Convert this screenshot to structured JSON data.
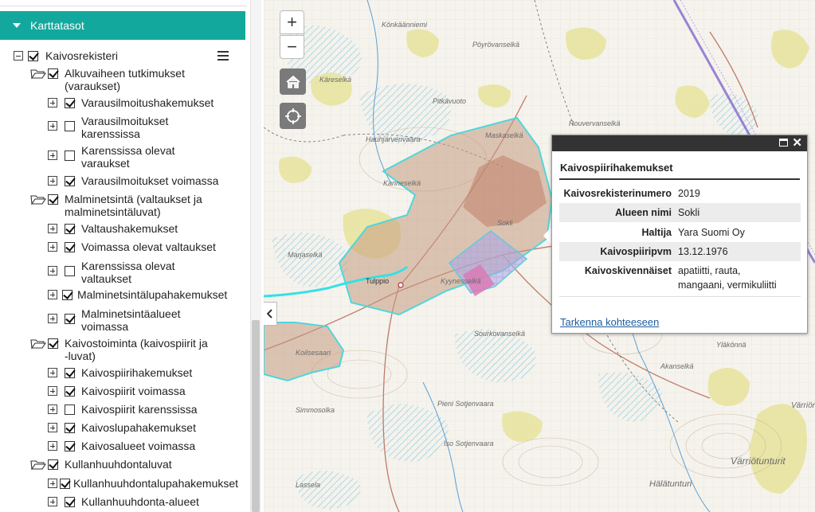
{
  "sidebar": {
    "header": "Karttatasot",
    "root": "Kaivosrekisteri",
    "groups": [
      {
        "label_l1": "Alkuvaiheen tutkimukset",
        "label_l2": "(varaukset)",
        "checked": true,
        "items": [
          {
            "l1": "Varausilmoitushakemukset",
            "l2": "",
            "checked": true
          },
          {
            "l1": "Varausilmoitukset",
            "l2": "karenssissa",
            "checked": false
          },
          {
            "l1": "Karenssissa olevat",
            "l2": "varaukset",
            "checked": false
          },
          {
            "l1": "Varausilmoitukset voimassa",
            "l2": "",
            "checked": true
          }
        ]
      },
      {
        "label_l1": "Malminetsintä (valtaukset ja",
        "label_l2": "malminetsintäluvat)",
        "checked": true,
        "items": [
          {
            "l1": "Valtaushakemukset",
            "l2": "",
            "checked": true
          },
          {
            "l1": "Voimassa olevat valtaukset",
            "l2": "",
            "checked": true
          },
          {
            "l1": "Karenssissa olevat",
            "l2": "valtaukset",
            "checked": false
          },
          {
            "l1": "Malminetsintälupahakemukset",
            "l2": "",
            "checked": true
          },
          {
            "l1": "Malminetsintäalueet",
            "l2": "voimassa",
            "checked": true
          }
        ]
      },
      {
        "label_l1": "Kaivostoiminta (kaivospiirit ja",
        "label_l2": "-luvat)",
        "checked": true,
        "items": [
          {
            "l1": "Kaivospiirihakemukset",
            "l2": "",
            "checked": true
          },
          {
            "l1": "Kaivospiirit voimassa",
            "l2": "",
            "checked": true
          },
          {
            "l1": "Kaivospiirit karenssissa",
            "l2": "",
            "checked": false
          },
          {
            "l1": "Kaivoslupahakemukset",
            "l2": "",
            "checked": true
          },
          {
            "l1": "Kaivosalueet voimassa",
            "l2": "",
            "checked": true
          }
        ]
      },
      {
        "label_l1": "Kullanhuuhdontaluvat",
        "label_l2": "",
        "checked": true,
        "items": [
          {
            "l1": "Kullanhuuhdontalupahakemukset",
            "l2": "",
            "checked": true
          },
          {
            "l1": "Kullanhuuhdonta-alueet",
            "l2": "",
            "checked": true
          }
        ]
      }
    ]
  },
  "map": {
    "zoom_in": "+",
    "zoom_out": "−",
    "place_names": [
      "Könkäänniemi",
      "Pöyrövanselkä",
      "Pitkävuoto",
      "Rouvervanselkä",
      "Hauhjärvenvaara",
      "Maskaselkä",
      "Käreselkä",
      "Kanneselkä",
      "Sokli",
      "Marjaselkä",
      "Tulppio",
      "Kyynesselkä",
      "Sourkovanselkä",
      "Koilsesaari",
      "Yläkönnä",
      "Simmosolka",
      "Pieni Sotjenvaara",
      "Iso Sotjenvaara",
      "Hälätunturi",
      "Värriötunturit",
      "Värriön",
      "Akanselkä",
      "Lassela"
    ]
  },
  "popup": {
    "title": "Kaivospiirihakemukset",
    "rows": [
      {
        "key": "Kaivosrekisterinumero",
        "value": "2019"
      },
      {
        "key": "Alueen nimi",
        "value": "Sokli"
      },
      {
        "key": "Haltija",
        "value": "Yara Suomi Oy"
      },
      {
        "key": "Kaivospiiripvm",
        "value": "13.12.1976"
      },
      {
        "key": "Kaivoskivennäiset",
        "value_l1": "apatiitti, rauta,",
        "value_l2": "mangaani, vermikuliitti"
      }
    ],
    "link": "Tarkenna kohteeseen",
    "close": "✕"
  }
}
